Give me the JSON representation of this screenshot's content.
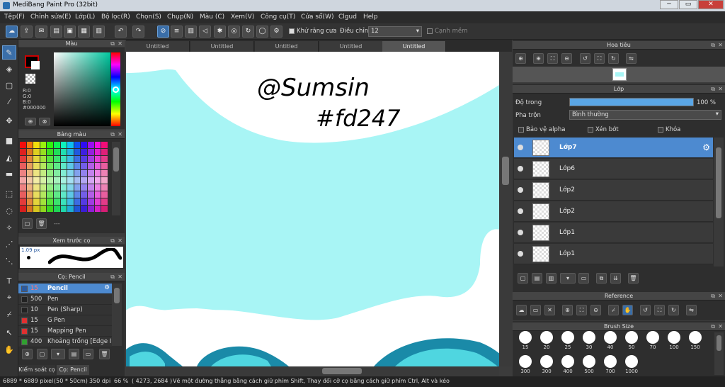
{
  "app": {
    "title": "MediBang Paint Pro (32bit)"
  },
  "window_controls": {
    "minimize": "─",
    "maximize": "▭",
    "close": "✕"
  },
  "menu": [
    "Tệp(F)",
    "Chỉnh sửa(E)",
    "Lớp(L)",
    "Bộ lọc(R)",
    "Chọn(S)",
    "Chụp(N)",
    "Màu (C)",
    "Xem(V)",
    "Công cụ(T)",
    "Cửa sổ(W)",
    "Clgud",
    "Help"
  ],
  "toolbar": {
    "antialias_label": "Khử răng cưa",
    "adjust_label": "Điều chỉnh",
    "adjust_value": "12",
    "edge_label": "Cạnh mềm"
  },
  "tabs": [
    "Untitled",
    "Untitled",
    "Untitled",
    "Untitled",
    "Untitled"
  ],
  "color_panel": {
    "title": "Màu",
    "r": "R:0",
    "g": "G:0",
    "b": "B:0",
    "hex": "#000000",
    "fg": "#000000",
    "bg": "#ffffff",
    "accent": "#cc0000"
  },
  "palette_panel": {
    "title": "Bảng màu",
    "footer": "---"
  },
  "brush_preview": {
    "title": "Xem trước cọ",
    "size": "1.09 px"
  },
  "brush_panel": {
    "title": "Cọ: Pencil",
    "items": [
      {
        "size": "15",
        "name": "Pencil",
        "color": "#2a5aa0"
      },
      {
        "size": "500",
        "name": "Pen",
        "color": "#222222"
      },
      {
        "size": "10",
        "name": "Pen (Sharp)",
        "color": "#222222"
      },
      {
        "size": "15",
        "name": "G Pen",
        "color": "#e03030"
      },
      {
        "size": "15",
        "name": "Mapping Pen",
        "color": "#e03030"
      },
      {
        "size": "400",
        "name": "Khoảng trống [Edge I",
        "color": "#30a030"
      }
    ],
    "tab1": "Kiểm soát cọ",
    "tab2": "Cọ: Pencil"
  },
  "navigator": {
    "title": "Hoa tiêu"
  },
  "layer_panel": {
    "title": "Lớp",
    "opacity_label": "Độ trong",
    "opacity_value": "100 %",
    "opacity": 1.0,
    "blend_label": "Pha trộn",
    "blend_value": "Bình thường",
    "protect_alpha": "Bảo vệ alpha",
    "clip": "Xén bớt",
    "lock": "Khóa",
    "layers": [
      "Lớp7",
      "Lớp6",
      "Lớp2",
      "Lớp2",
      "Lớp1",
      "Lớp1"
    ]
  },
  "reference_panel": {
    "title": "Reference"
  },
  "brush_size_panel": {
    "title": "Brush Size",
    "sizes_row1": [
      "15",
      "20",
      "25",
      "30",
      "40",
      "50",
      "70",
      "100",
      "150"
    ],
    "sizes_row2": [
      "300",
      "300",
      "400",
      "500",
      "700",
      "1000"
    ]
  },
  "canvas": {
    "text1": "@Sumsin",
    "text2": "#fd247",
    "sky": "#a8f5f5",
    "cloud": "#ffffff",
    "wave": "#1a8aa8"
  },
  "status": {
    "size": "6889 * 6889 pixel",
    "cm": "(50 * 50cm)",
    "dpi": "350 dpi",
    "zoom": "66 %",
    "coords": "( 4273, 2684 )",
    "hint": "Vẽ một đường thẳng bằng cách giữ phím Shift, Thay đổi cỡ cọ bằng cách giữ phím Ctrl, Alt và kéo"
  }
}
